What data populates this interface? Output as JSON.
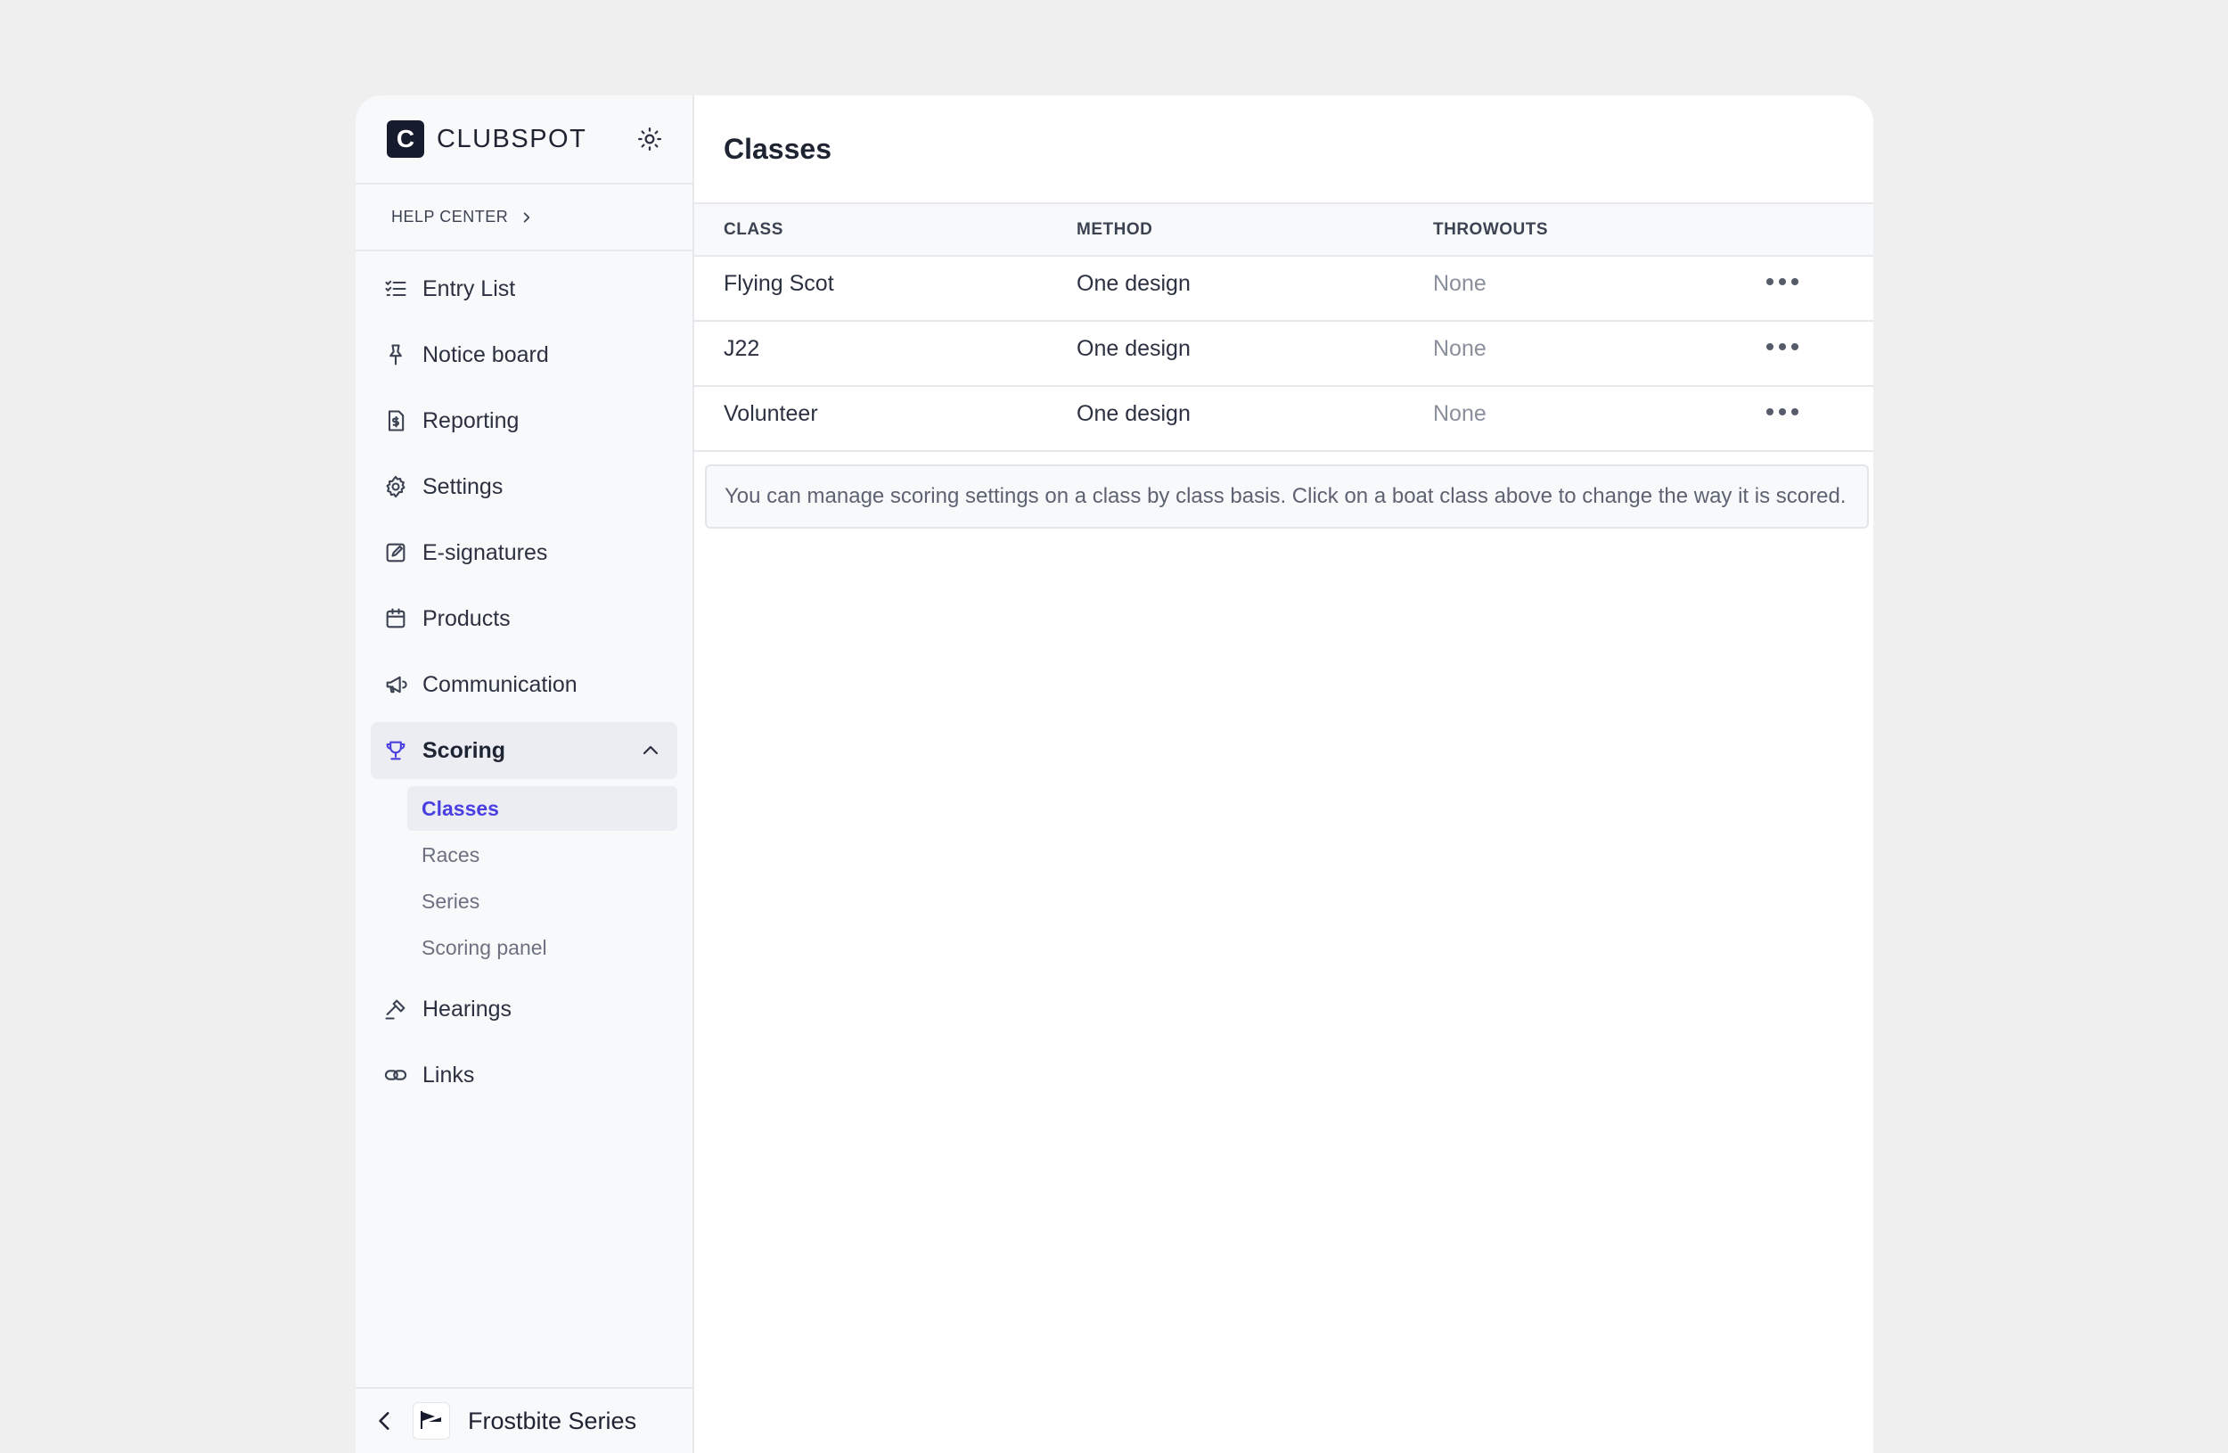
{
  "brand": {
    "name": "CLUBSPOT",
    "logo_letter": "C"
  },
  "help": {
    "label": "HELP CENTER"
  },
  "nav": {
    "items": [
      {
        "label": "Entry List",
        "icon": "checklist-icon"
      },
      {
        "label": "Notice board",
        "icon": "pin-icon"
      },
      {
        "label": "Reporting",
        "icon": "invoice-icon"
      },
      {
        "label": "Settings",
        "icon": "gear-icon"
      },
      {
        "label": "E-signatures",
        "icon": "signature-icon"
      },
      {
        "label": "Products",
        "icon": "calendar-icon"
      },
      {
        "label": "Communication",
        "icon": "megaphone-icon"
      },
      {
        "label": "Scoring",
        "icon": "trophy-icon"
      },
      {
        "label": "Hearings",
        "icon": "gavel-icon"
      },
      {
        "label": "Links",
        "icon": "link-icon"
      }
    ],
    "scoring_sub": [
      "Classes",
      "Races",
      "Series",
      "Scoring panel"
    ]
  },
  "footer": {
    "event_name": "Frostbite Series"
  },
  "main": {
    "title": "Classes",
    "columns": [
      "CLASS",
      "METHOD",
      "THROWOUTS"
    ],
    "rows": [
      {
        "class": "Flying Scot",
        "method": "One design",
        "throwouts": "None"
      },
      {
        "class": "J22",
        "method": "One design",
        "throwouts": "None"
      },
      {
        "class": "Volunteer",
        "method": "One design",
        "throwouts": "None"
      }
    ],
    "info": "You can manage scoring settings on a class by class basis. Click on a boat class above to change the way it is scored."
  },
  "colors": {
    "accent": "#4a3fe0",
    "sidebar_bg": "#f8f9fb",
    "logo_bg": "#161b2e"
  }
}
